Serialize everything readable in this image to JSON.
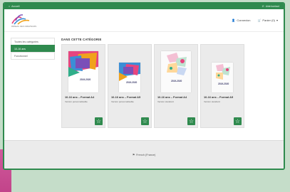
{
  "topbar": {
    "left_label": "Accueil",
    "right_label": "Aide/contact"
  },
  "header": {
    "logo_text": "RÉSEAU DES CRÉATEURS",
    "account_label": "Connexion",
    "cart_label": "Panier (0)"
  },
  "sidebar": {
    "items": [
      {
        "label": "Toutes les catégories",
        "active": false
      },
      {
        "label": "10-16 ans",
        "active": true
      },
      {
        "label": "Fonctionnel",
        "active": false
      }
    ]
  },
  "main": {
    "section_title": "DANS CETTE CATÉGORIE",
    "products": [
      {
        "title": "10-16 ans – Format A4",
        "subtitle": "Version personnalisable",
        "year": "2019-2020"
      },
      {
        "title": "10-16 ans – Format A5",
        "subtitle": "Version personnalisable",
        "year": "2019-2020"
      },
      {
        "title": "10-16 ans – Format A4",
        "subtitle": "Version standard",
        "year": "2019-2020"
      },
      {
        "title": "10-16 ans – Format A5",
        "subtitle": "Version standard",
        "year": "2019-2020"
      }
    ]
  },
  "footer": {
    "language_label": "French (France)"
  },
  "colors": {
    "accent": "#2f8a4e",
    "card_bg": "#ebebeb",
    "page_bg": "#c5ddc9"
  }
}
